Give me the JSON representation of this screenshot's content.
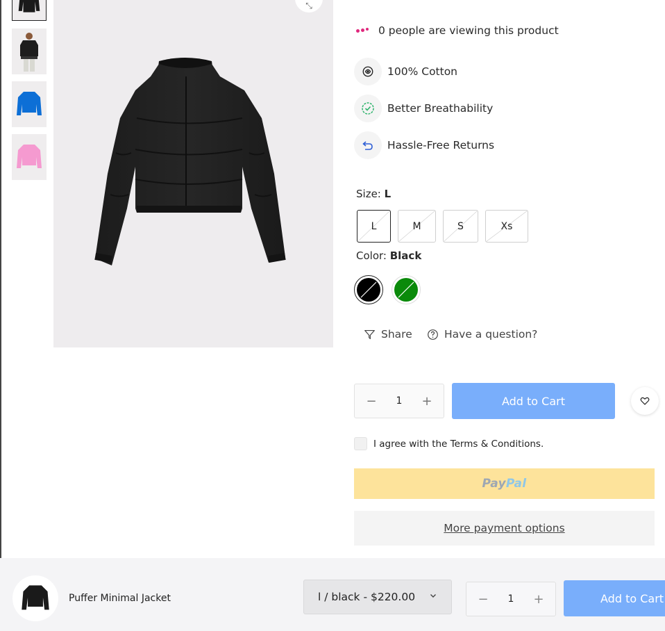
{
  "product": {
    "viewers_text": "0 people are viewing this product",
    "features": [
      {
        "icon": "cotton-icon",
        "label": "100% Cotton"
      },
      {
        "icon": "check-circle-icon",
        "label": "Better Breathability"
      },
      {
        "icon": "return-icon",
        "label": "Hassle-Free Returns"
      }
    ],
    "size": {
      "label": "Size:",
      "selected": "L",
      "options": [
        "L",
        "M",
        "S",
        "Xs"
      ]
    },
    "color": {
      "label": "Color:",
      "selected": "Black",
      "options": [
        {
          "name": "Black",
          "hex": "#000000"
        },
        {
          "name": "Green",
          "hex": "#0a8a0a"
        }
      ]
    },
    "share_label": "Share",
    "question_label": "Have a question?",
    "quantity": "1",
    "add_to_cart": "Add to Cart",
    "terms_text": "I agree with the Terms & Conditions.",
    "paypal": {
      "part1": "Pay",
      "part2": "Pal"
    },
    "more_payment": "More payment options",
    "thumbnail_colors": [
      "#1a1a1a",
      "#2a2a2a",
      "#0d6fd6",
      "#f59ad0"
    ]
  },
  "sticky_bar": {
    "title": "Puffer Minimal Jacket",
    "variant": "l / black - $220.00",
    "quantity": "1",
    "add_to_cart": "Add to Cart"
  },
  "colors": {
    "accent_button": "#79aefb",
    "paypal_bg": "#fde39b",
    "viewer_dots": "#e0287d"
  }
}
